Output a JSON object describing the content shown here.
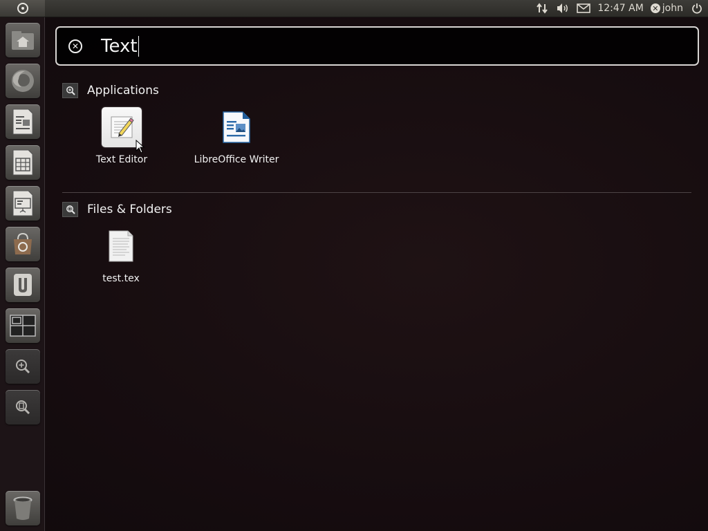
{
  "top_panel": {
    "clock": "12:47 AM",
    "user": "john",
    "icons": [
      "network-icon",
      "volume-icon",
      "mail-icon",
      "user-status-icon",
      "power-icon"
    ]
  },
  "launcher": {
    "items": [
      {
        "name": "home-folder",
        "icon": "home-icon"
      },
      {
        "name": "firefox",
        "icon": "firefox-icon"
      },
      {
        "name": "libreoffice-writer",
        "icon": "writer-icon"
      },
      {
        "name": "libreoffice-calc",
        "icon": "calc-icon"
      },
      {
        "name": "libreoffice-impress",
        "icon": "impress-icon"
      },
      {
        "name": "software-center",
        "icon": "software-center-icon"
      },
      {
        "name": "ubuntu-one",
        "icon": "ubuntu-one-icon"
      },
      {
        "name": "workspace-switcher",
        "icon": "workspace-icon"
      },
      {
        "name": "applications-lens",
        "icon": "apps-lens-icon"
      },
      {
        "name": "files-lens",
        "icon": "files-lens-icon"
      },
      {
        "name": "trash",
        "icon": "trash-icon"
      }
    ]
  },
  "search": {
    "query": "Text"
  },
  "categories": {
    "applications": {
      "title": "Applications",
      "items": [
        {
          "label": "Text Editor",
          "icon": "text-editor-icon"
        },
        {
          "label": "LibreOffice Writer",
          "icon": "libreoffice-writer-icon"
        }
      ]
    },
    "files": {
      "title": "Files & Folders",
      "items": [
        {
          "label": "test.tex",
          "icon": "text-file-icon"
        }
      ]
    }
  }
}
